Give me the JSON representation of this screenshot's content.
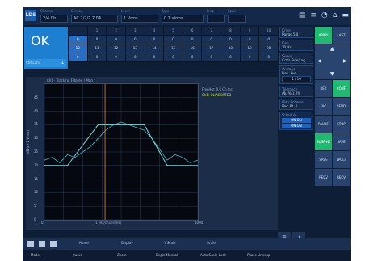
{
  "header": {
    "logo": "LDS",
    "fields": [
      {
        "label": "Channel",
        "value": "2/4 Ch"
      },
      {
        "label": "Sensor",
        "value": "AC  2/2/7  7.04"
      },
      {
        "label": "Level",
        "value": "1 Vrms"
      },
      {
        "label": "Type",
        "value": "0.1 v/rms"
      },
      {
        "label": "Freq",
        "value": ""
      },
      {
        "label": "Span",
        "value": ""
      }
    ],
    "sys_icons": [
      "document-icon",
      "database-icon",
      "wifi-icon",
      "home-icon",
      "battery-icon"
    ]
  },
  "status": {
    "text": "OK",
    "sub_label": "Ctrl Limit",
    "sub_value": "1"
  },
  "channel_grid": {
    "header": [
      "",
      "1",
      "2",
      "3",
      "4",
      "5",
      "6",
      "7",
      "8",
      "9",
      "10"
    ],
    "rows": [
      [
        "0",
        "0",
        "0",
        "0",
        "0",
        "0",
        "0",
        "0",
        "0",
        "0",
        "0"
      ],
      [
        "10",
        "11",
        "12",
        "13",
        "14",
        "15",
        "16",
        "17",
        "18",
        "19",
        "20"
      ],
      [
        "0",
        "0",
        "0",
        "0",
        "0",
        "0",
        "0",
        "0",
        "0",
        "0",
        "0"
      ]
    ]
  },
  "plot": {
    "title": "Ch1 · Tracking Filtered / Mag",
    "ylabel": "dB (re 1 Vrms)",
    "xlabel": "1 [Hz/ch1 Filter]",
    "legend": [
      "Freq/Hz: 0.0 Ch Inc",
      "Ch1: OL/ABORTED"
    ]
  },
  "info": {
    "boxes": [
      {
        "title": "Drive",
        "value": "Range  5.0"
      },
      {
        "title": "Freq",
        "value": "20 Hz"
      },
      {
        "title": "Sweep",
        "value": "Oct/s  Sine/Log"
      },
      {
        "title": "Average",
        "value": "Mov. Ave",
        "box": "1 / 16"
      },
      {
        "title": "Tolerance",
        "value": "Ab. %  1.2%"
      },
      {
        "title": "Rate Scheme",
        "value": "Rec. Rt.  2"
      },
      {
        "title": "Schedule",
        "box_blue": "ON  ON"
      }
    ]
  },
  "buttons": {
    "row1": [
      "APPLY",
      "LAST"
    ],
    "row2": [
      "REC",
      "CONF"
    ],
    "row3": [
      "FAC",
      "SEND"
    ],
    "row4": [
      "PAUSE",
      "STOP"
    ],
    "row5": [
      "SUSPND",
      "SAVE"
    ],
    "row6": [
      "SAVE",
      "LPULT"
    ],
    "row7": [
      "RECV",
      "RECV"
    ]
  },
  "bottom_bar": [
    "Home",
    "Display",
    "Y Scale",
    "Scale"
  ],
  "bottom_bar2": [
    "Mode",
    "Curve",
    "Zoom",
    "Begin Manual",
    "Auto Scale Lock",
    "Phase Unwrap"
  ],
  "chart_data": {
    "type": "line",
    "title": "Ch1 · Tracking Filtered / Mag",
    "xlabel": "1 [Hz/ch1 Filter]",
    "ylabel": "dB (re 1 Vrms)",
    "xlim": [
      0,
      1000
    ],
    "ylim": [
      0,
      50
    ],
    "yticks": [
      0,
      5,
      10,
      15,
      20,
      25,
      30,
      35,
      40,
      45
    ],
    "xticks": [
      0,
      1000
    ],
    "cursor_x": 395,
    "series": [
      {
        "name": "Response",
        "x": [
          0,
          50,
          100,
          150,
          200,
          250,
          300,
          350,
          400,
          450,
          500,
          550,
          600,
          650,
          700,
          750,
          800,
          850,
          900,
          950,
          1000
        ],
        "y": [
          22,
          23,
          21,
          24,
          23,
          25,
          27,
          30,
          33,
          35,
          36,
          35,
          34,
          33,
          30,
          26,
          22,
          24,
          23,
          21,
          22
        ]
      },
      {
        "name": "Profile",
        "x": [
          0,
          150,
          350,
          450,
          650,
          800,
          1000
        ],
        "y": [
          20,
          20,
          35,
          35,
          35,
          20,
          20
        ]
      }
    ]
  }
}
